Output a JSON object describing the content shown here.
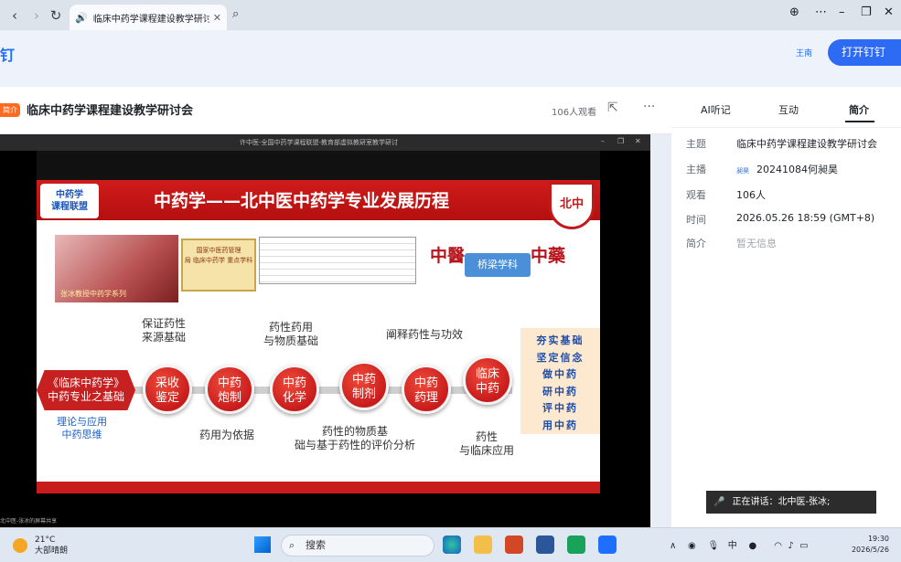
{
  "browser": {
    "tab_title": "临床中药学课程建设教学研讨",
    "close_symbol": "✕"
  },
  "app": {
    "brand_fragment": "钉",
    "user_chip": "王南",
    "open_button": "打开钉钉"
  },
  "live": {
    "badge": "简介",
    "title": "临床中药学课程建设教学研讨会",
    "views": "106人观看",
    "share_title": "许中医-全国中药学课程联盟-教育部虚拟教研室教学研讨",
    "footer_hint": "北中医-张冰的屏幕共享"
  },
  "slide": {
    "alliance": "中药学课程联盟",
    "heading": "中药学——北中医中药学专业发展历程",
    "photo_caption": "张冰教授中药学系列",
    "certificate": "国家中医药管理局 临床中药学 重点学科",
    "zhongyi": "中醫",
    "bridge": "桥梁学科",
    "zhongyao": "中藥",
    "seal": "北中",
    "left_hex": "《临床中药学》中药专业之基础",
    "nodes": [
      "采收鉴定",
      "中药炮制",
      "中药化学",
      "中药制剂",
      "中药药理",
      "临床中药"
    ],
    "labels_top": [
      "保证药性来源基础",
      "药性药用与物质基础",
      "阐释药性与功效"
    ],
    "labels_bottom": [
      "药用为依据",
      "药性的物质基础与基于药性的评价分析",
      "药性与临床应用"
    ],
    "blue_note": "理论与应用中药思维",
    "right_box": [
      "夯实基础",
      "坚定信念",
      "做中药",
      "研中药",
      "评中药",
      "用中药"
    ]
  },
  "panel": {
    "tabs": [
      "AI听记",
      "互动",
      "简介"
    ],
    "info": {
      "topic_key": "主题",
      "topic_value": "临床中药学课程建设教学研讨会",
      "host_key": "主播",
      "host_chip": "昶昊",
      "host_value": "20241084何昶昊",
      "views_key": "观看",
      "views_value": "106人",
      "time_key": "时间",
      "time_value": "2026.05.26 18:59 (GMT+8)",
      "intro_key": "简介",
      "intro_value": "暂无信息"
    }
  },
  "speaking": {
    "text": "正在讲话：北中医-张冰;"
  },
  "taskbar": {
    "temperature": "21°C",
    "weather": "大部晴朗",
    "search": "搜索",
    "ime": "中",
    "time": "19:30",
    "date": "2026/5/26"
  }
}
